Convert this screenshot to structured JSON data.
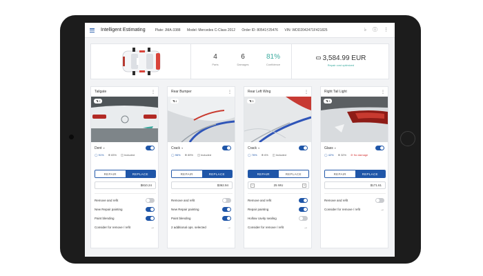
{
  "topbar": {
    "title": "Intelligent Estimating",
    "plate": "Plate: JMA-3388",
    "model": "Model: Mercedes C-Class 2012",
    "order": "Order ID: 80541†25476",
    "vin": "VIN: WDD2042471F421825"
  },
  "summary": {
    "parts_value": "4",
    "parts_label": "Parts",
    "damages_value": "6",
    "damages_label": "Damages",
    "confidence_value": "81%",
    "confidence_label": "Confidence",
    "price": "3,584.99 EUR",
    "price_note": "Repair cost optimized"
  },
  "colors": {
    "primary": "#1f56a8",
    "teal": "#3aaa9e",
    "danger": "#d33030"
  },
  "cards": [
    {
      "title": "Tailgate",
      "photo_count": "2",
      "damage_type": "Dent",
      "damage_on": true,
      "stat1": "91%",
      "stat2": "83%",
      "stat3": "Included",
      "repair_label": "REPAIR",
      "replace_label": "REPLACE",
      "selected": "replace",
      "value": "$810.24",
      "options": [
        {
          "label": "Remove and refit",
          "on": false
        },
        {
          "label": "New Repair painting",
          "on": true
        },
        {
          "label": "Paint blending",
          "on": true
        }
      ],
      "footer": "Consider for remove / refit"
    },
    {
      "title": "Rear Bumper",
      "photo_count": "4",
      "damage_type": "Crack",
      "damage_on": true,
      "stat1": "96%",
      "stat2": "89%",
      "stat3": "Included",
      "repair_label": "REPAIR",
      "replace_label": "REPLACE",
      "selected": "replace",
      "value": "$362.94",
      "options": [
        {
          "label": "Remove and refit",
          "on": false
        },
        {
          "label": "New Repair painting",
          "on": true
        },
        {
          "label": "Paint blending",
          "on": true
        }
      ],
      "footer": "2 additional ops. selected"
    },
    {
      "title": "Rear Left Wing",
      "photo_count": "3",
      "damage_type": "Crack",
      "damage_on": true,
      "stat1": "76%",
      "stat2": "6%",
      "stat3": "Included",
      "repair_label": "REPAIR",
      "replace_label": "REPLACE",
      "selected": "repair",
      "value": "25 WU",
      "options": [
        {
          "label": "Remove and refit",
          "on": true
        },
        {
          "label": "Repair painting",
          "on": true
        },
        {
          "label": "Hollow cavity sealing",
          "on": false
        }
      ],
      "footer": "Consider for remove / refit"
    },
    {
      "title": "Right Tail Light",
      "photo_count": "3",
      "damage_type": "Glass",
      "damage_on": true,
      "stat1": "42%",
      "stat2": "32%",
      "stat3": "No damage",
      "repair_label": "REPAIR",
      "replace_label": "REPLACE",
      "selected": "replace",
      "value": "$171.61",
      "options": [
        {
          "label": "Remove and refit",
          "on": false
        }
      ],
      "footer": "Consider for remove / refit"
    }
  ]
}
